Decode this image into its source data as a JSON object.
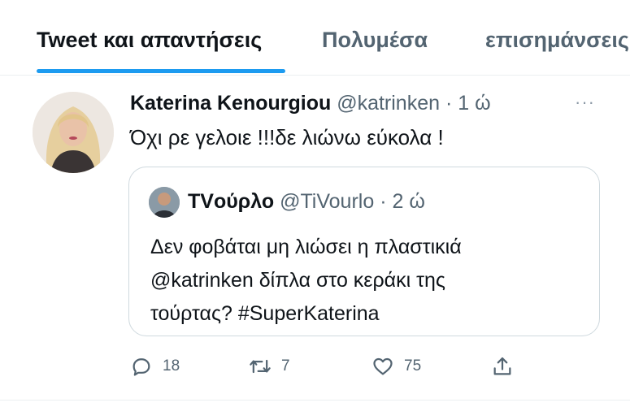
{
  "tabs": [
    {
      "label": "Tweet και απαντήσεις",
      "active": true
    },
    {
      "label": "Πολυμέσα",
      "active": false
    },
    {
      "label": "επισημάνσεις",
      "active": false
    }
  ],
  "tweet": {
    "author_name": "Katerina Kenourgiou",
    "handle": "@katrinken",
    "separator": "·",
    "time": "1 ώ",
    "more_label": "···",
    "text": "Όχι ρε γελοιε !!!δε λιώνω εύκολα !",
    "quote": {
      "author_name": "TVούρλο",
      "handle": "@TiVourlo",
      "separator": "·",
      "time": "2 ώ",
      "lines": [
        "Δεν φοβάται μη λιώσει η πλαστικιά",
        "@katrinken δίπλα στο κεράκι της",
        "τούρτας? #SuperKaterina"
      ]
    },
    "actions": {
      "reply_count": "18",
      "retweet_count": "7",
      "like_count": "75"
    }
  },
  "colors": {
    "accent": "#1d9bf0",
    "secondary_text": "#536471",
    "primary_text": "#0f1419",
    "border": "#cfd9de"
  },
  "icons": [
    "reply-icon",
    "retweet-icon",
    "like-icon",
    "share-icon",
    "more-icon"
  ]
}
